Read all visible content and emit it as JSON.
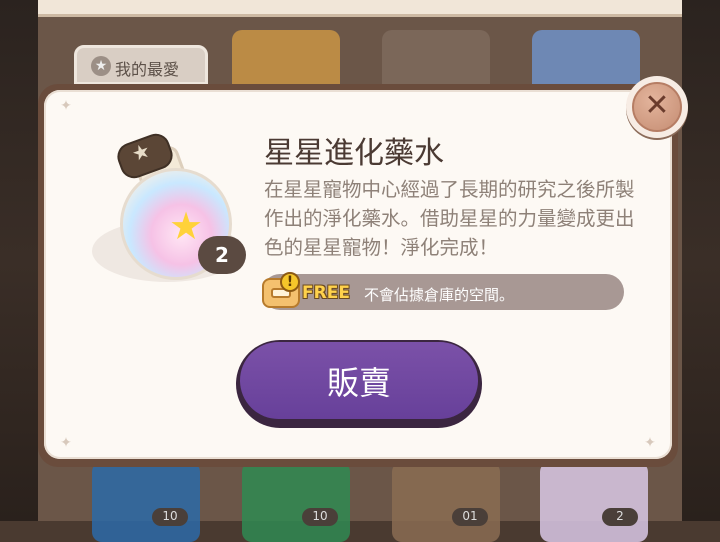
{
  "background": {
    "favorites_tab_label": "我的最愛",
    "bottom_counts": [
      "10",
      "10",
      "01",
      "2"
    ]
  },
  "dialog": {
    "item_name": "星星進化藥水",
    "description": "在星星寵物中心經過了長期的研究之後所製作出的淨化藥水。借助星星的力量變成更出色的星星寵物！淨化完成！",
    "quantity": "2",
    "free_badge": "FREE",
    "storage_note": "不會佔據倉庫的空間。",
    "sell_button": "販賣",
    "close_icon": "close-icon",
    "colors": {
      "button": "#67409a",
      "frame": "#6a4c3c",
      "panel": "#fdf9f4"
    }
  }
}
